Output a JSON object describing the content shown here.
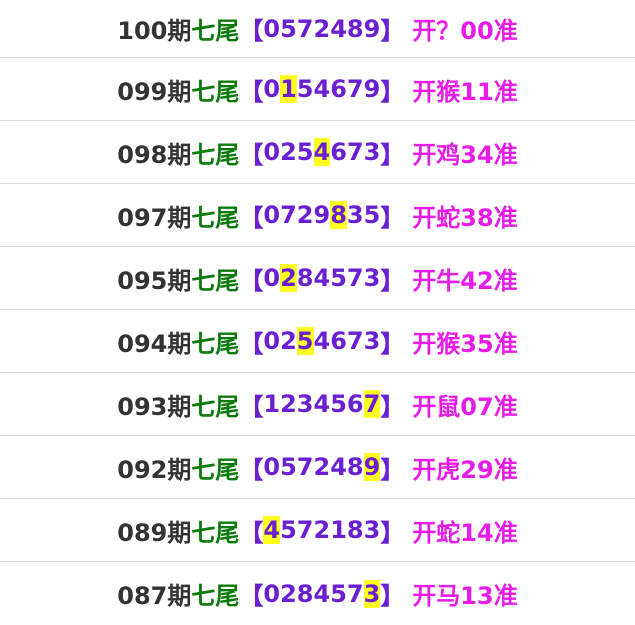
{
  "colors": {
    "issue": "#333333",
    "tail": "#0a7a0a",
    "numbers": "#6a1fd0",
    "result": "#e81ce8",
    "highlight": "#ffff22",
    "divider": "#d8d8d8"
  },
  "rows": [
    {
      "issue": "100期",
      "tail": "七尾",
      "open": "【",
      "digits": [
        "0",
        "5",
        "7",
        "2",
        "4",
        "8",
        "9"
      ],
      "hit": -1,
      "close": "】",
      "result": "开？00准"
    },
    {
      "issue": "099期",
      "tail": "七尾",
      "open": "【",
      "digits": [
        "0",
        "1",
        "5",
        "4",
        "6",
        "7",
        "9"
      ],
      "hit": 1,
      "close": "】",
      "result": "开猴11准"
    },
    {
      "issue": "098期",
      "tail": "七尾",
      "open": "【",
      "digits": [
        "0",
        "2",
        "5",
        "4",
        "6",
        "7",
        "3"
      ],
      "hit": 3,
      "close": "】",
      "result": "开鸡34准"
    },
    {
      "issue": "097期",
      "tail": "七尾",
      "open": "【",
      "digits": [
        "0",
        "7",
        "2",
        "9",
        "8",
        "3",
        "5"
      ],
      "hit": 4,
      "close": "】",
      "result": "开蛇38准"
    },
    {
      "issue": "095期",
      "tail": "七尾",
      "open": "【",
      "digits": [
        "0",
        "2",
        "8",
        "4",
        "5",
        "7",
        "3"
      ],
      "hit": 1,
      "close": "】",
      "result": "开牛42准"
    },
    {
      "issue": "094期",
      "tail": "七尾",
      "open": "【",
      "digits": [
        "0",
        "2",
        "5",
        "4",
        "6",
        "7",
        "3"
      ],
      "hit": 2,
      "close": "】",
      "result": "开猴35准"
    },
    {
      "issue": "093期",
      "tail": "七尾",
      "open": "【",
      "digits": [
        "1",
        "2",
        "3",
        "4",
        "5",
        "6",
        "7"
      ],
      "hit": 6,
      "close": "】",
      "result": "开鼠07准"
    },
    {
      "issue": "092期",
      "tail": "七尾",
      "open": "【",
      "digits": [
        "0",
        "5",
        "7",
        "2",
        "4",
        "8",
        "9"
      ],
      "hit": 6,
      "close": "】",
      "result": "开虎29准"
    },
    {
      "issue": "089期",
      "tail": "七尾",
      "open": "【",
      "digits": [
        "4",
        "5",
        "7",
        "2",
        "1",
        "8",
        "3"
      ],
      "hit": 0,
      "close": "】",
      "result": "开蛇14准"
    },
    {
      "issue": "087期",
      "tail": "七尾",
      "open": "【",
      "digits": [
        "0",
        "2",
        "8",
        "4",
        "5",
        "7",
        "3"
      ],
      "hit": 6,
      "close": "】",
      "result": "开马13准"
    }
  ]
}
